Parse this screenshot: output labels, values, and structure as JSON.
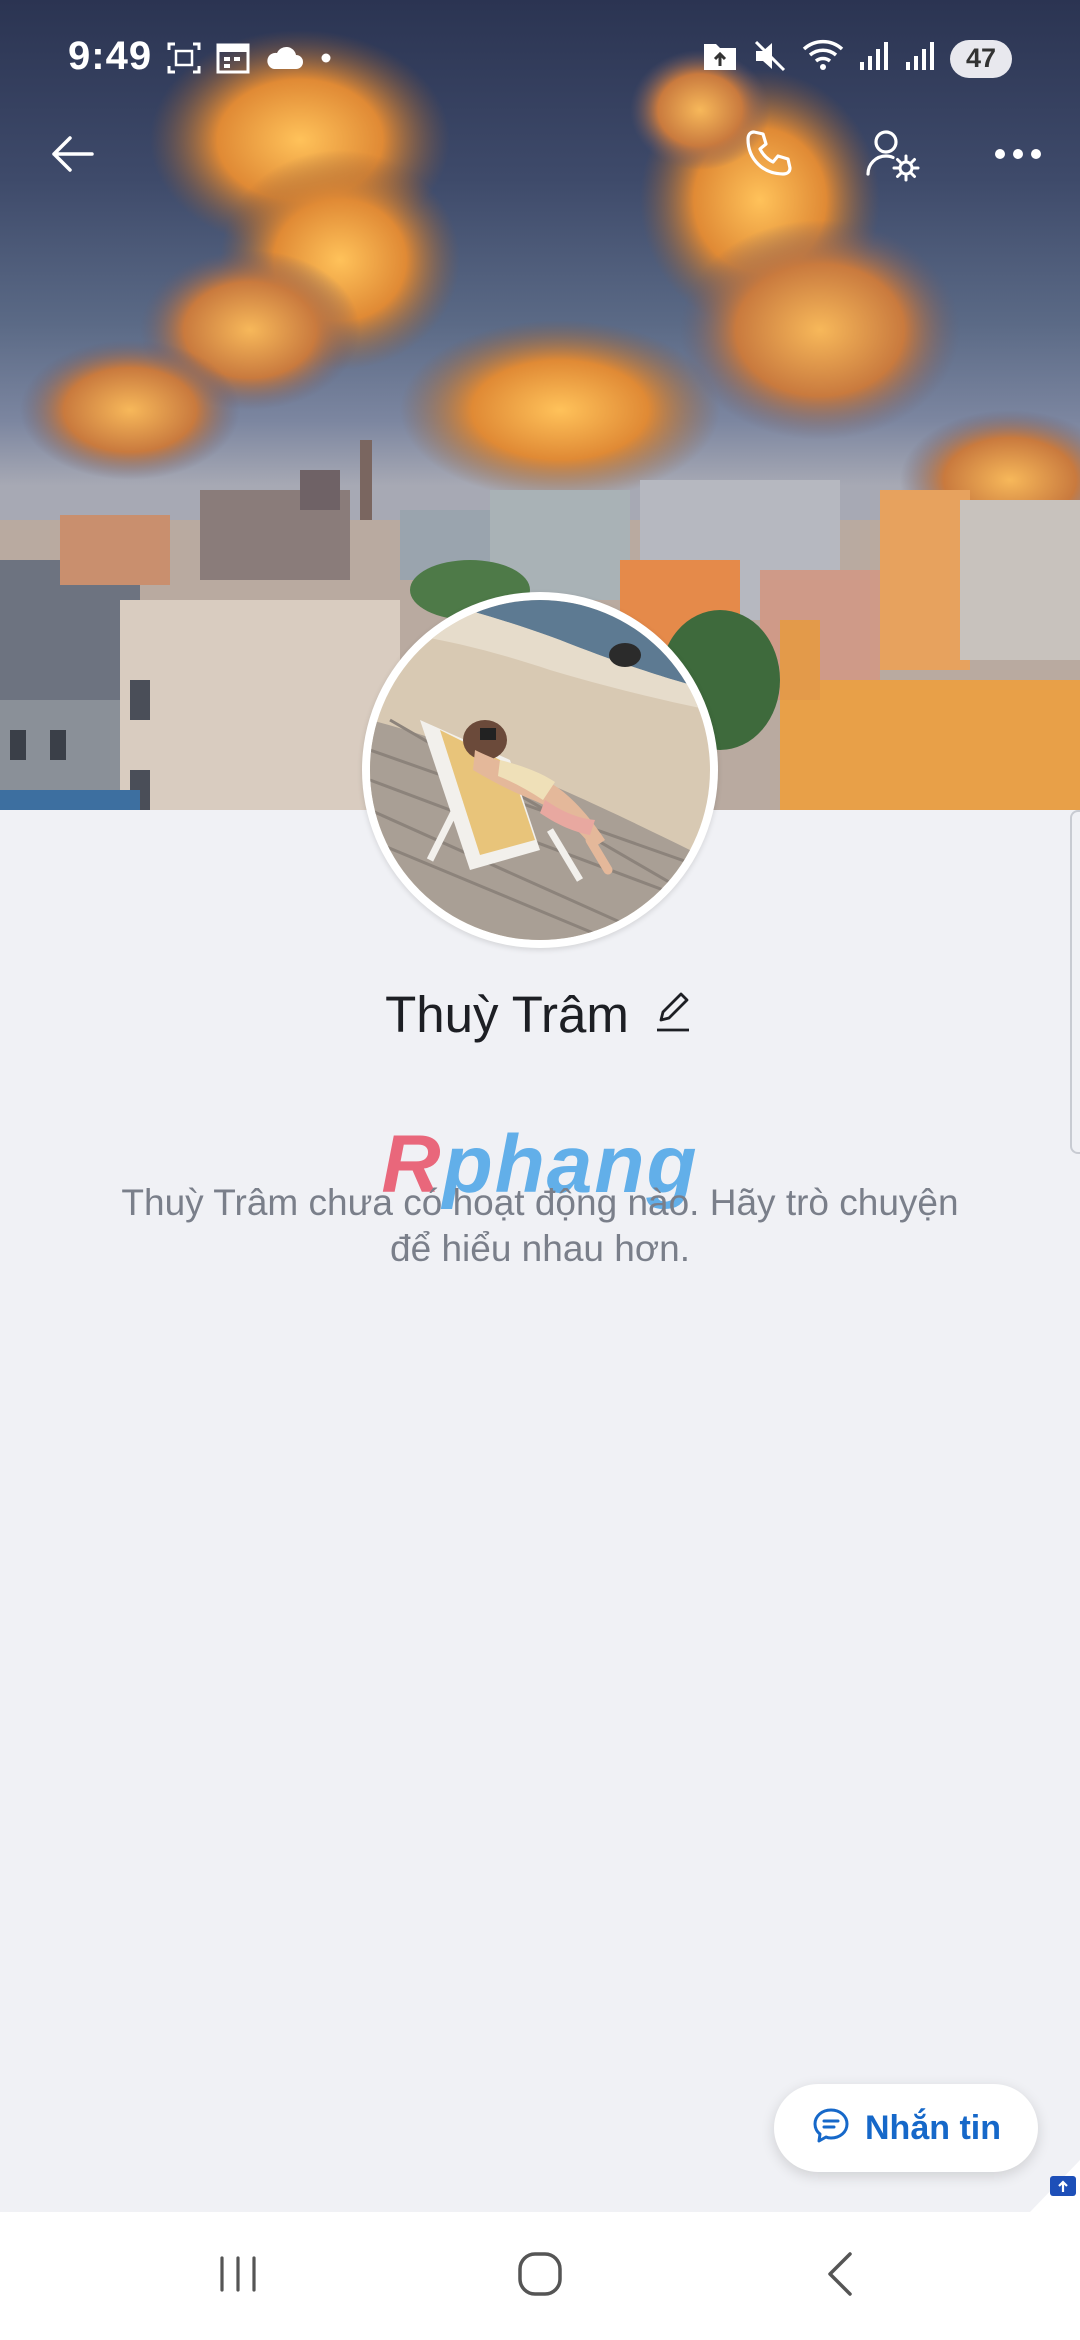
{
  "status_bar": {
    "time": "9:49",
    "battery": "47",
    "left_icons": [
      "screenshot-icon",
      "calendar-icon",
      "cloud-icon",
      "dot-icon"
    ],
    "right_icons": [
      "upload-folder-icon",
      "mute-icon",
      "wifi-icon",
      "signal-icon",
      "signal-icon"
    ]
  },
  "toolbar": {
    "back_icon": "arrow-left-icon",
    "call_icon": "phone-icon",
    "settings_icon": "user-settings-icon",
    "more_icon": "more-horizontal-icon"
  },
  "profile": {
    "name": "Thuỳ Trâm",
    "edit_icon": "pencil-icon"
  },
  "empty_state": {
    "line1": "Thuỳ Trâm chưa có hoạt động nào. Hãy trò chuyện",
    "line2": "để hiểu nhau hơn."
  },
  "watermark": {
    "prefix": "R",
    "rest": "phang"
  },
  "message_button": {
    "label": "Nhắn tin",
    "icon": "chat-bubble-icon"
  },
  "nav_bar": {
    "recent_icon": "recent-apps-icon",
    "home_icon": "home-icon",
    "back_icon": "back-chevron-icon"
  },
  "colors": {
    "accent": "#1668c9",
    "background": "#f0f1f5",
    "text_primary": "#1d1f24",
    "text_secondary": "#7a7f8a"
  }
}
